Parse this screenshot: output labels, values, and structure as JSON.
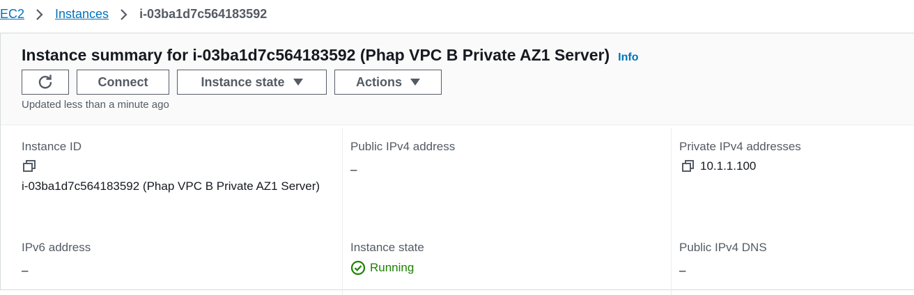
{
  "breadcrumb": {
    "root": "EC2",
    "section": "Instances",
    "current": "i-03ba1d7c564183592"
  },
  "header": {
    "title": "Instance summary for i-03ba1d7c564183592 (Phap VPC B Private AZ1 Server)",
    "info": "Info",
    "updated": "Updated less than a minute ago"
  },
  "toolbar": {
    "refresh_icon": "refresh-icon",
    "connect_label": "Connect",
    "instance_state_label": "Instance state",
    "actions_label": "Actions"
  },
  "details": {
    "instance_id": {
      "label": "Instance ID",
      "value": "i-03ba1d7c564183592 (Phap VPC B Private AZ1 Server)"
    },
    "public_ipv4": {
      "label": "Public IPv4 address",
      "value": "–"
    },
    "private_ipv4": {
      "label": "Private IPv4 addresses",
      "value": "10.1.1.100"
    },
    "ipv6": {
      "label": "IPv6 address",
      "value": "–"
    },
    "instance_state": {
      "label": "Instance state",
      "value": "Running",
      "color": "#1d8102"
    },
    "public_dns": {
      "label": "Public IPv4 DNS",
      "value": "–"
    }
  },
  "colors": {
    "link": "#0073bb",
    "running": "#1d8102",
    "muted": "#545b64"
  }
}
